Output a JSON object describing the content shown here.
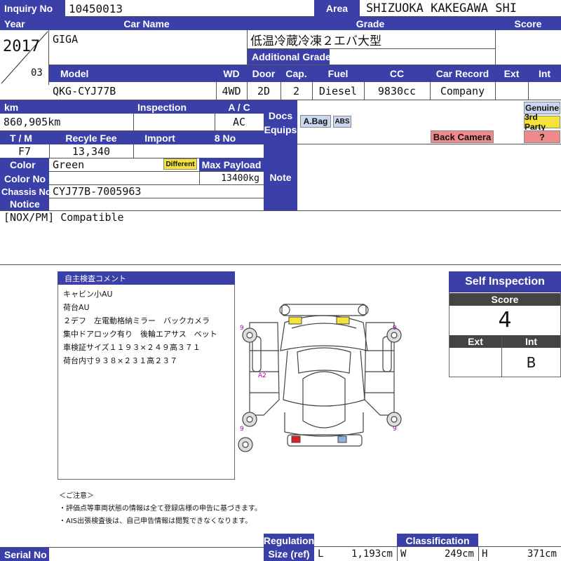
{
  "labels": {
    "inquiry_no": "Inquiry No",
    "area": "Area",
    "year": "Year",
    "car_name": "Car Name",
    "grade": "Grade",
    "score": "Score",
    "additional_grade": "Additional Grade",
    "model": "Model",
    "wd": "WD",
    "door": "Door",
    "cap": "Cap.",
    "fuel": "Fuel",
    "cc": "CC",
    "car_record": "Car Record",
    "ext": "Ext",
    "int": "Int",
    "km": "km",
    "inspection": "Inspection",
    "ac": "A / C",
    "docs": "Docs",
    "equips": "Equips",
    "tm": "T / M",
    "recycle_fee": "Recyle Fee",
    "import": "Import",
    "eight_no": "8 No",
    "color": "Color",
    "max_payload": "Max Payload",
    "color_no": "Color No",
    "note": "Note",
    "chassis_no": "Chassis No",
    "notice": "Notice",
    "regulation": "Regulation",
    "size_ref": "Size (ref)",
    "classification": "Classification",
    "serial_no": "Serial No",
    "len_l": "L",
    "len_w": "W",
    "len_h": "H"
  },
  "vehicle": {
    "inquiry_no": "10450013",
    "area": "SHIZUOKA KAKEGAWA SHI",
    "year": "2017",
    "month": "03",
    "car_name": "GIGA",
    "grade": "低温冷蔵冷凍２エバ大型",
    "model": "QKG-CYJ77B",
    "wd": "4WD",
    "door": "2D",
    "cap": "2",
    "fuel": "Diesel",
    "cc": "9830cc",
    "car_record": "Company",
    "km": "860,905km",
    "ac": "AC",
    "tm": "F7",
    "recycle_fee": "13,340",
    "color": "Green",
    "max_payload": "13400kg",
    "chassis_no": "CYJ77B-7005963",
    "notice": "[NOX/PM] Compatible"
  },
  "badges": {
    "abag": "A.Bag",
    "abs": "ABS",
    "back_camera": "Back Camera",
    "genuine": "Genuine",
    "third_party": "3rd Party",
    "question": "?",
    "different": "Different"
  },
  "comment": {
    "title": "自主検査コメント",
    "lines": [
      "キャビン小AU",
      "荷台AU",
      "２デフ　左電動格納ミラー　バックカメラ",
      "集中ドアロック有り　後輪エアサス　ベット",
      "車検証サイズ１１９３×２４９高３７１",
      "荷台内寸９３８×２３１高２３７"
    ]
  },
  "diagram_marks": [
    "9",
    "9",
    "9",
    "9",
    "A2"
  ],
  "self_inspection": {
    "title": "Self Inspection",
    "score_label": "Score",
    "score": "4",
    "ext_label": "Ext",
    "int_label": "Int",
    "ext": "",
    "int": "B"
  },
  "footnote": {
    "title": "＜ご注意＞",
    "lines": [
      "・評価点等車両状態の情報は全て登録店様の申告に基づきます。",
      "・AIS出張検査後は、自己申告情報は閲覧できなくなります。"
    ]
  },
  "size": {
    "l": "1,193cm",
    "w": "249cm",
    "h": "371cm"
  },
  "colors": {
    "header_blue": "#3b3fa8",
    "abag_bg": "#c9d8ee",
    "back_camera_bg": "#f08a8a",
    "genuine_bg": "#c9d8ee",
    "third_party_bg": "#f5e33a",
    "question_bg": "#f08a8a",
    "different_bg": "#f5e33a"
  }
}
